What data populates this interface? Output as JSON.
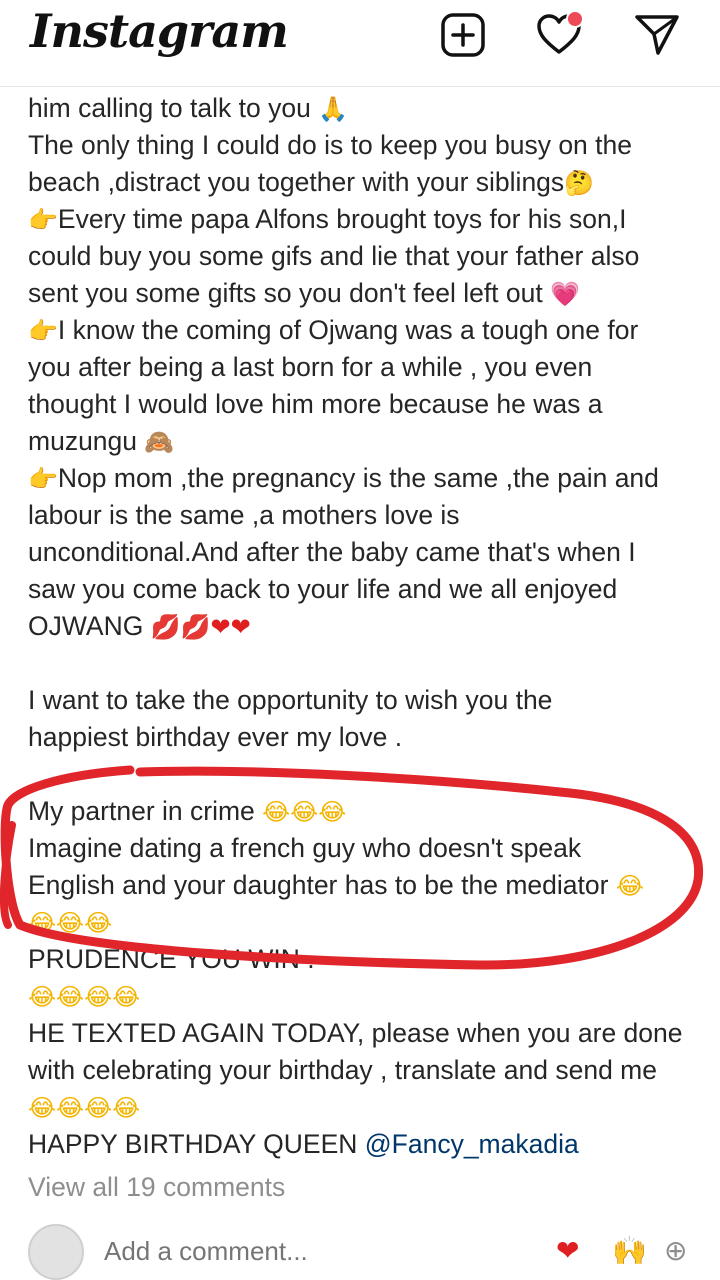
{
  "header": {
    "logo": "Instagram",
    "icons": [
      "new-post-icon",
      "heart-icon",
      "direct-message-icon"
    ],
    "notification_color": "#ed4956"
  },
  "caption": {
    "lines": [
      {
        "text": "him calling to talk to you ",
        "emoji": "🙏"
      },
      {
        "text": "The only thing I could do is to keep you busy on the"
      },
      {
        "text": "beach ,distract you  together with your siblings",
        "emoji": "🤔"
      },
      {
        "lead": "👉",
        "text": "Every time papa Alfons brought toys for his son,I"
      },
      {
        "text": "could buy you some gifs and lie that your father also"
      },
      {
        "text": "sent you some gifts so you don't feel left out ",
        "emoji": "💗"
      },
      {
        "lead": "👉",
        "text": "I know the coming of Ojwang was a tough one for"
      },
      {
        "text": "you after being a last born for a while , you even"
      },
      {
        "text": "thought I would love him more because he was a"
      },
      {
        "text": "muzungu ",
        "emoji": "🙈"
      },
      {
        "lead": "👉",
        "text": "Nop mom ,the pregnancy is the same ,the pain and"
      },
      {
        "text": "labour is the same ,a mothers love is"
      },
      {
        "text": "unconditional.And after the baby came that's when I"
      },
      {
        "text": "saw you come back to your life and we all enjoyed"
      },
      {
        "text": "OJWANG ",
        "emoji": "💋💋❤❤"
      },
      {
        "text": ""
      },
      {
        "text": "I want to take the opportunity to wish you the"
      },
      {
        "text": "happiest birthday ever my love ."
      },
      {
        "text": ""
      },
      {
        "text": "My partner in crime ",
        "emoji": "😂😂😂"
      },
      {
        "text": "Imagine dating a french guy who doesn't speak"
      },
      {
        "text": "English and your daughter has to be the mediator ",
        "emoji": "😂"
      },
      {
        "text": "",
        "emoji": "😂😂😂"
      },
      {
        "text": "PRUDENCE YOU WIN ."
      },
      {
        "text": "",
        "emoji": "😂😂😂😂"
      },
      {
        "text": "HE TEXTED AGAIN TODAY, please when you are done"
      },
      {
        "text": "with celebrating your birthday , translate and send me"
      },
      {
        "text": "",
        "emoji": "😂😂😂😂"
      },
      {
        "text": "HAPPY BIRTHDAY QUEEN ",
        "mention": "@Fancy_makadia"
      }
    ]
  },
  "comments": {
    "view_all": "View all 19 comments",
    "add_placeholder": "Add a comment...",
    "quick_reactions": [
      "❤",
      "🙌",
      "⊕"
    ]
  },
  "annotation": {
    "stroke_color": "#e0262b"
  }
}
